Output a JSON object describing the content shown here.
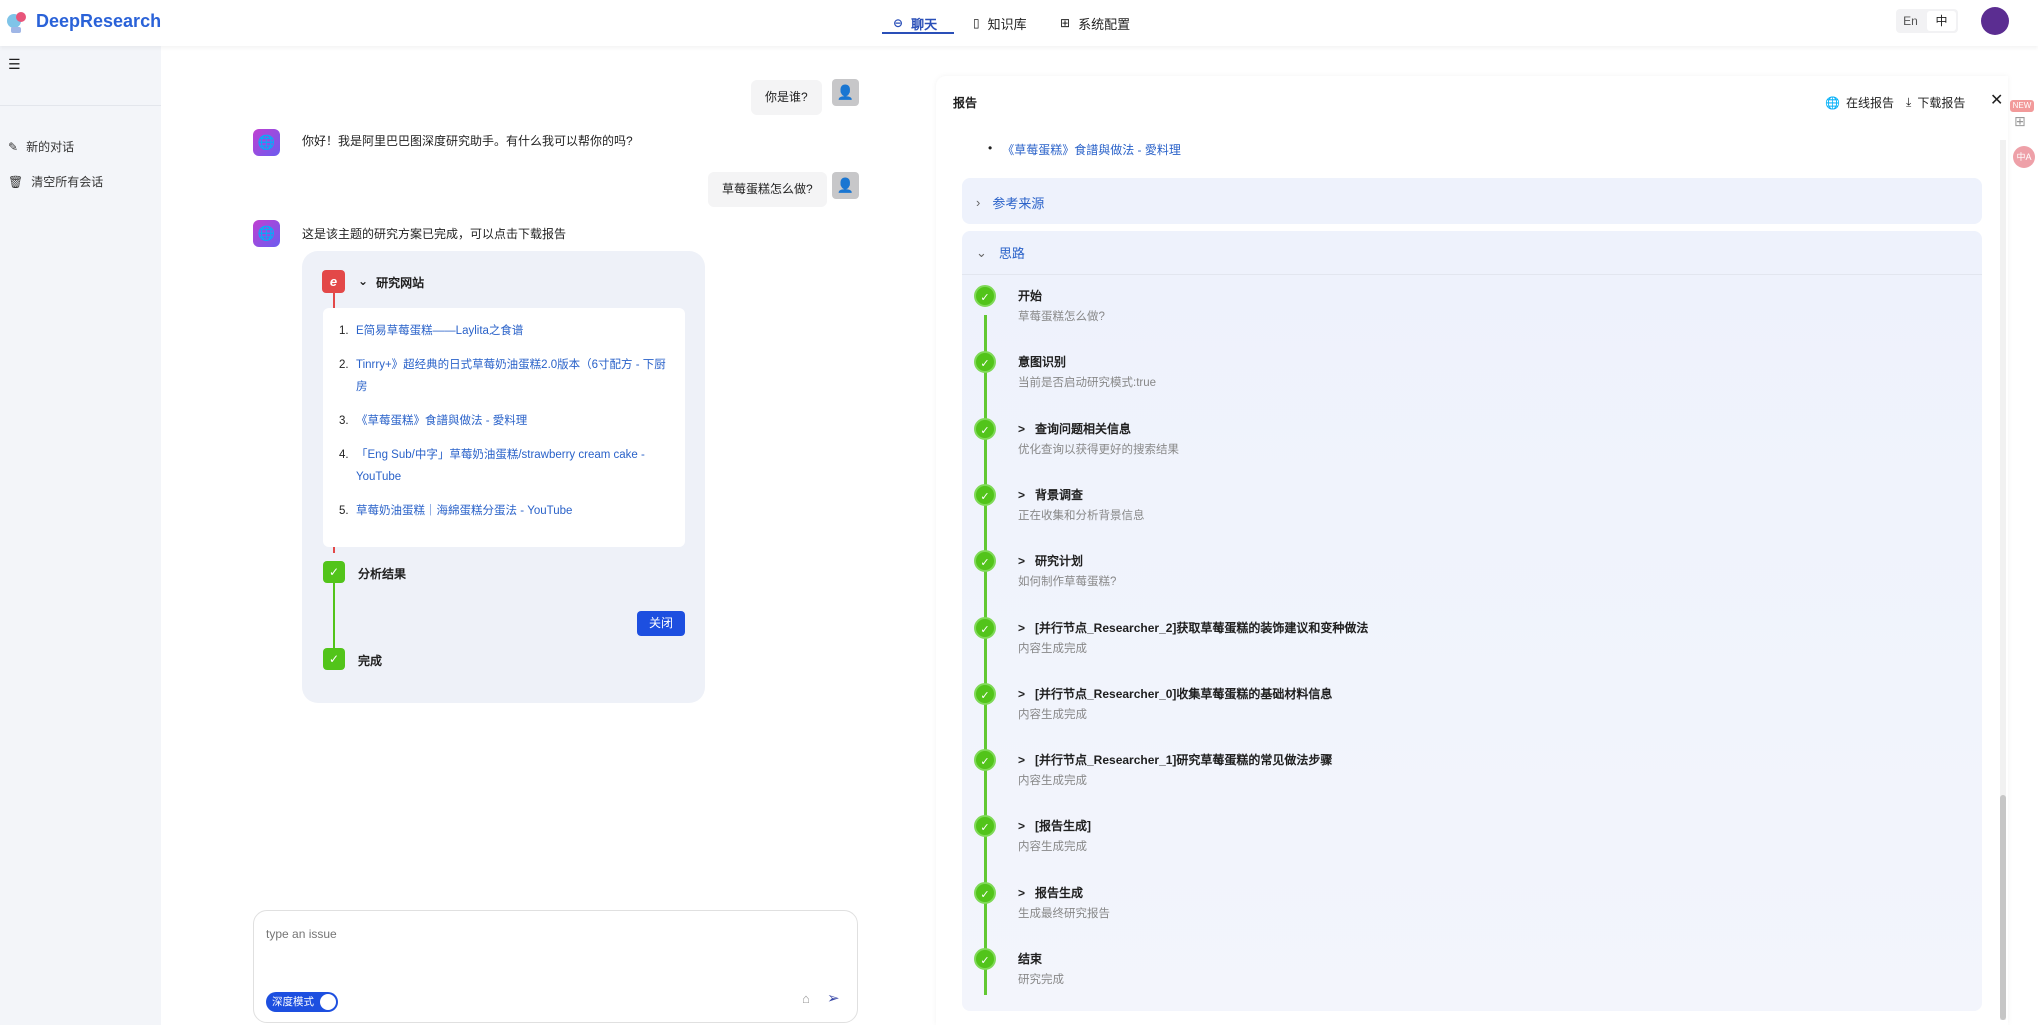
{
  "header": {
    "brand": "DeepResearch",
    "nav": [
      {
        "label": "聊天",
        "icon": "chat-icon"
      },
      {
        "label": "知识库",
        "icon": "book-icon"
      },
      {
        "label": "系统配置",
        "icon": "settings-icon"
      }
    ],
    "lang": [
      "En",
      "中"
    ]
  },
  "sidebar": {
    "items": [
      {
        "label": "新的对话",
        "icon": "edit-icon"
      },
      {
        "label": "清空所有会话",
        "icon": "trash-icon"
      }
    ]
  },
  "chat": {
    "messages": [
      {
        "role": "user",
        "text": "你是谁?"
      },
      {
        "role": "bot",
        "text": "你好！我是阿里巴巴图深度研究助手。有什么我可以帮你的吗?"
      },
      {
        "role": "user",
        "text": "草莓蛋糕怎么做?"
      },
      {
        "role": "bot",
        "text": "这是该主题的研究方案已完成，可以点击下载报告"
      }
    ],
    "card": {
      "sites_title": "研究网站",
      "sites": [
        "E简易草莓蛋糕——Laylita之食谱",
        "Tinrry+》超经典的日式草莓奶油蛋糕2.0版本（6寸配方 - 下厨房",
        "《草莓蛋糕》食譜與做法 - 愛料理",
        "「Eng Sub/中字」草莓奶油蛋糕/strawberry cream cake - YouTube",
        "草莓奶油蛋糕｜海綿蛋糕分蛋法 - YouTube"
      ],
      "analysis": "分析结果",
      "close": "关闭",
      "done": "完成"
    },
    "input": {
      "placeholder": "type an issue",
      "mode": "深度模式",
      "mode_on": true
    }
  },
  "report": {
    "title": "报告",
    "online": "在线报告",
    "download": "下载报告",
    "bullet_link": "《草莓蛋糕》食譜與做法 - 愛料理",
    "refs_title": "参考来源",
    "flow_title": "思路",
    "steps": [
      {
        "title": "开始",
        "sub": "草莓蛋糕怎么做?",
        "expand": false
      },
      {
        "title": "意图识别",
        "sub": "当前是否启动研究模式:true",
        "expand": false
      },
      {
        "title": "查询问题相关信息",
        "sub": "优化查询以获得更好的搜索结果",
        "expand": true
      },
      {
        "title": "背景调查",
        "sub": "正在收集和分析背景信息",
        "expand": true
      },
      {
        "title": "研究计划",
        "sub": "如何制作草莓蛋糕?",
        "expand": true
      },
      {
        "title": "[并行节点_Researcher_2]获取草莓蛋糕的装饰建议和变种做法",
        "sub": "内容生成完成",
        "expand": true
      },
      {
        "title": "[并行节点_Researcher_0]收集草莓蛋糕的基础材料信息",
        "sub": "内容生成完成",
        "expand": true
      },
      {
        "title": "[并行节点_Researcher_1]研究草莓蛋糕的常见做法步骤",
        "sub": "内容生成完成",
        "expand": true
      },
      {
        "title": "[报告生成]",
        "sub": "内容生成完成",
        "expand": true
      },
      {
        "title": "报告生成",
        "sub": "生成最终研究报告",
        "expand": true
      },
      {
        "title": "结束",
        "sub": "研究完成",
        "expand": false
      }
    ]
  },
  "floating": {
    "badge": "NEW"
  }
}
